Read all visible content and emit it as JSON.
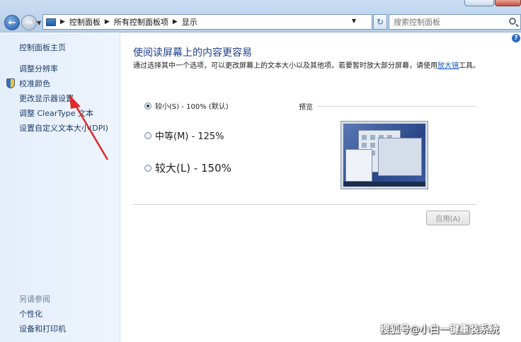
{
  "address_bar": {
    "crumbs": [
      "控制面板",
      "所有控制面板项",
      "显示"
    ]
  },
  "search": {
    "placeholder": "搜索控制面板"
  },
  "sidebar": {
    "home": "控制面板主页",
    "tasks": [
      "调整分辨率",
      "校准颜色",
      "更改显示器设置",
      "调整 ClearType 文本",
      "设置自定义文本大小(DPI)"
    ],
    "see_also_title": "另请参阅",
    "see_also": [
      "个性化",
      "设备和打印机"
    ]
  },
  "main": {
    "heading": "使阅读屏幕上的内容更容易",
    "description": "通过选择其中一个选项，可以更改屏幕上的文本大小以及其他项。若要暂时放大部分屏幕，请使用",
    "magnifier_link": "放大镜",
    "description_end": "工具。",
    "options": [
      {
        "label": "较小(S) - 100% (默认)",
        "checked": true
      },
      {
        "label": "中等(M) - 125%",
        "checked": false
      },
      {
        "label": "较大(L) - 150%",
        "checked": false
      }
    ],
    "preview_label": "预览",
    "apply_button": "应用(A)"
  },
  "help_icon": "?",
  "watermark": "搜狐号@小白一键重装系统",
  "colors": {
    "heading": "#1f3e8c",
    "link": "#0b5bc6",
    "annotation_arrow": "#e02a2a"
  }
}
